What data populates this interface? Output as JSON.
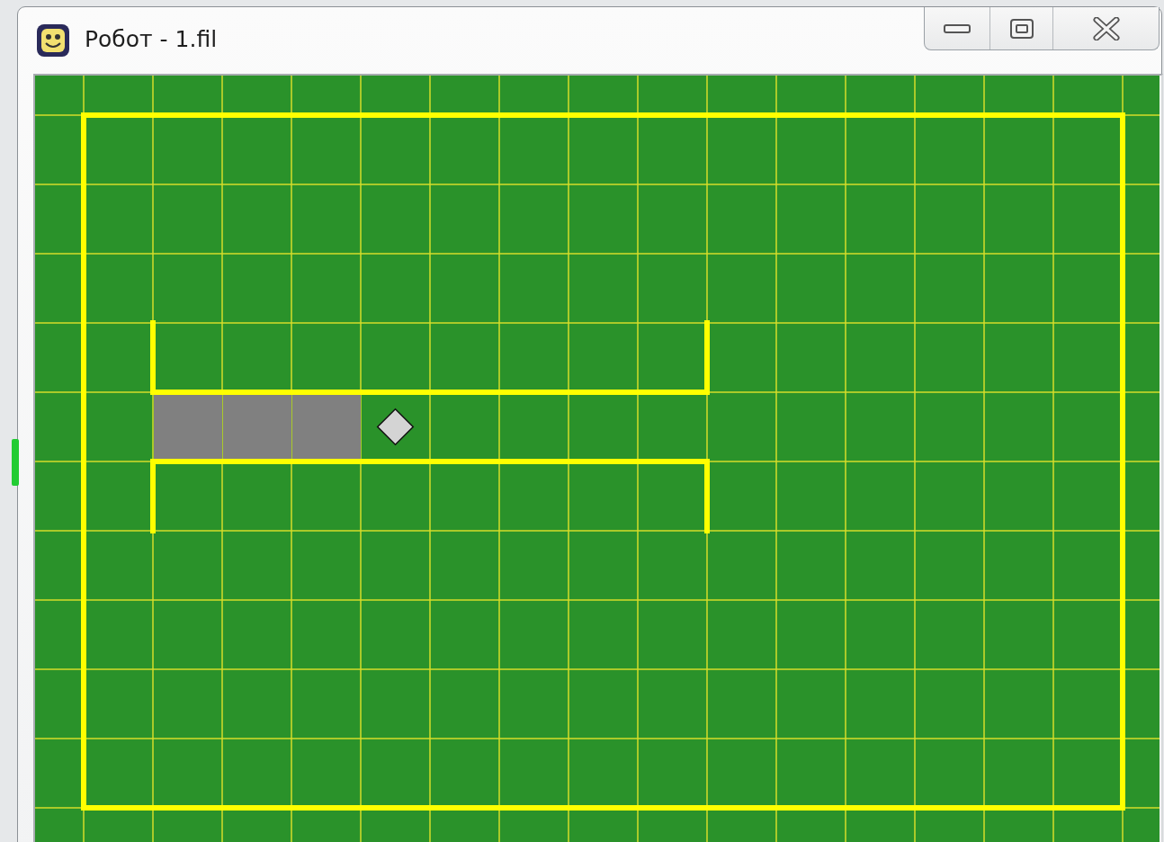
{
  "window": {
    "title": "Робот - 1.fil"
  }
}
